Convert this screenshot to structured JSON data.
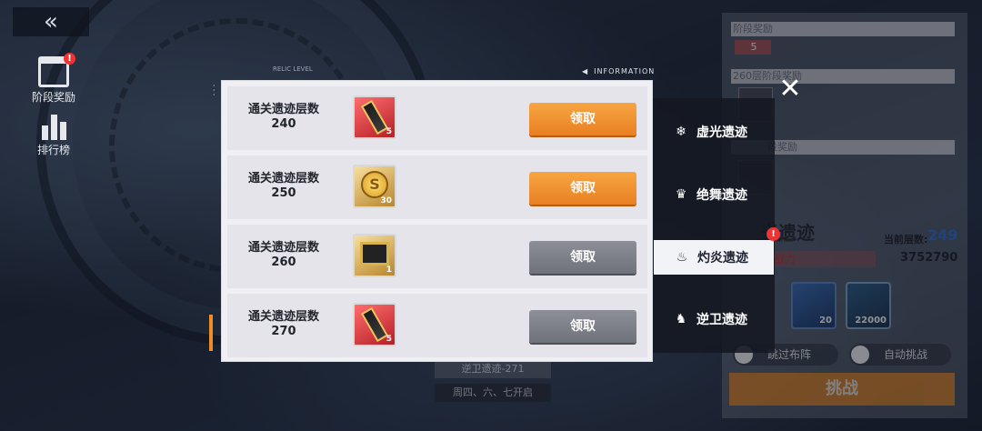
{
  "top": {
    "back_icon": "double-chevron-left-icon"
  },
  "side_buttons": [
    {
      "label": "阶段奖励",
      "icon": "gift-icon"
    },
    {
      "label": "排行榜",
      "icon": "bar-chart-icon"
    }
  ],
  "modal": {
    "info_label": "INFORMATION",
    "relic_label": "RELIC LEVEL",
    "rows": [
      {
        "label_line1": "通关遗迹层数",
        "floor": "240",
        "item_count": "5",
        "item_icon": "red-ticket-icon",
        "claim_label": "领取",
        "claimable": true
      },
      {
        "label_line1": "通关遗迹层数",
        "floor": "250",
        "item_count": "30",
        "item_icon": "gold-coin-icon",
        "claim_label": "领取",
        "claimable": true
      },
      {
        "label_line1": "通关遗迹层数",
        "floor": "260",
        "item_count": "1",
        "item_icon": "gold-chest-icon",
        "claim_label": "领取",
        "claimable": false
      },
      {
        "label_line1": "通关遗迹层数",
        "floor": "270",
        "item_count": "5",
        "item_icon": "red-ticket-icon",
        "claim_label": "领取",
        "claimable": false
      }
    ]
  },
  "tabs": [
    {
      "label": "虚光遗迹",
      "icon": "snowflake-icon",
      "active": false
    },
    {
      "label": "绝舞遗迹",
      "icon": "crest-icon",
      "active": false
    },
    {
      "label": "灼炎遗迹",
      "icon": "flame-icon",
      "active": true,
      "alert": "!"
    },
    {
      "label": "逆卫遗迹",
      "icon": "shield-wing-icon",
      "active": false
    }
  ],
  "right_panel": {
    "section1": "阶段奖励",
    "section1_count": "5",
    "section2": "260层阶段奖励",
    "section3": "段奖励",
    "title": "光遗迹",
    "title_sub": "INFORMATION",
    "current_floor_label": "当前层数:",
    "current_floor": "249",
    "power_tag": "战力",
    "power_value": "3752790",
    "rewards": [
      {
        "icon": "blue-crystal-icon",
        "count": "20"
      },
      {
        "icon": "exp-card-icon",
        "count": "22000"
      }
    ],
    "skip_formation_label": "跳过布阵",
    "auto_challenge_label": "自动挑战",
    "challenge_label": "挑战"
  },
  "bottom_center": {
    "stage_label": "逆卫遗迹-271",
    "schedule_label": "周四、六、七开启"
  },
  "close_icon": "close-icon"
}
